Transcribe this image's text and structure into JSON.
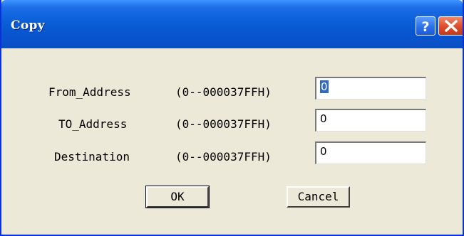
{
  "window": {
    "title": "Copy"
  },
  "titlebar_buttons": {
    "help": "help-icon",
    "close": "close-icon"
  },
  "form": {
    "rows": [
      {
        "label": "From_Address",
        "range": "(0--000037FFH)",
        "value": "0"
      },
      {
        "label": "TO_Address",
        "range": "(0--000037FFH)",
        "value": "0"
      },
      {
        "label": "Destination",
        "range": "(0--000037FFH)",
        "value": "0"
      }
    ]
  },
  "buttons": {
    "ok": "OK",
    "cancel": "Cancel"
  },
  "colors": {
    "titlebar": "#0a5fd8",
    "close_button": "#dd4b2a",
    "dialog_bg": "#ece9d8",
    "selection": "#316ac5"
  }
}
